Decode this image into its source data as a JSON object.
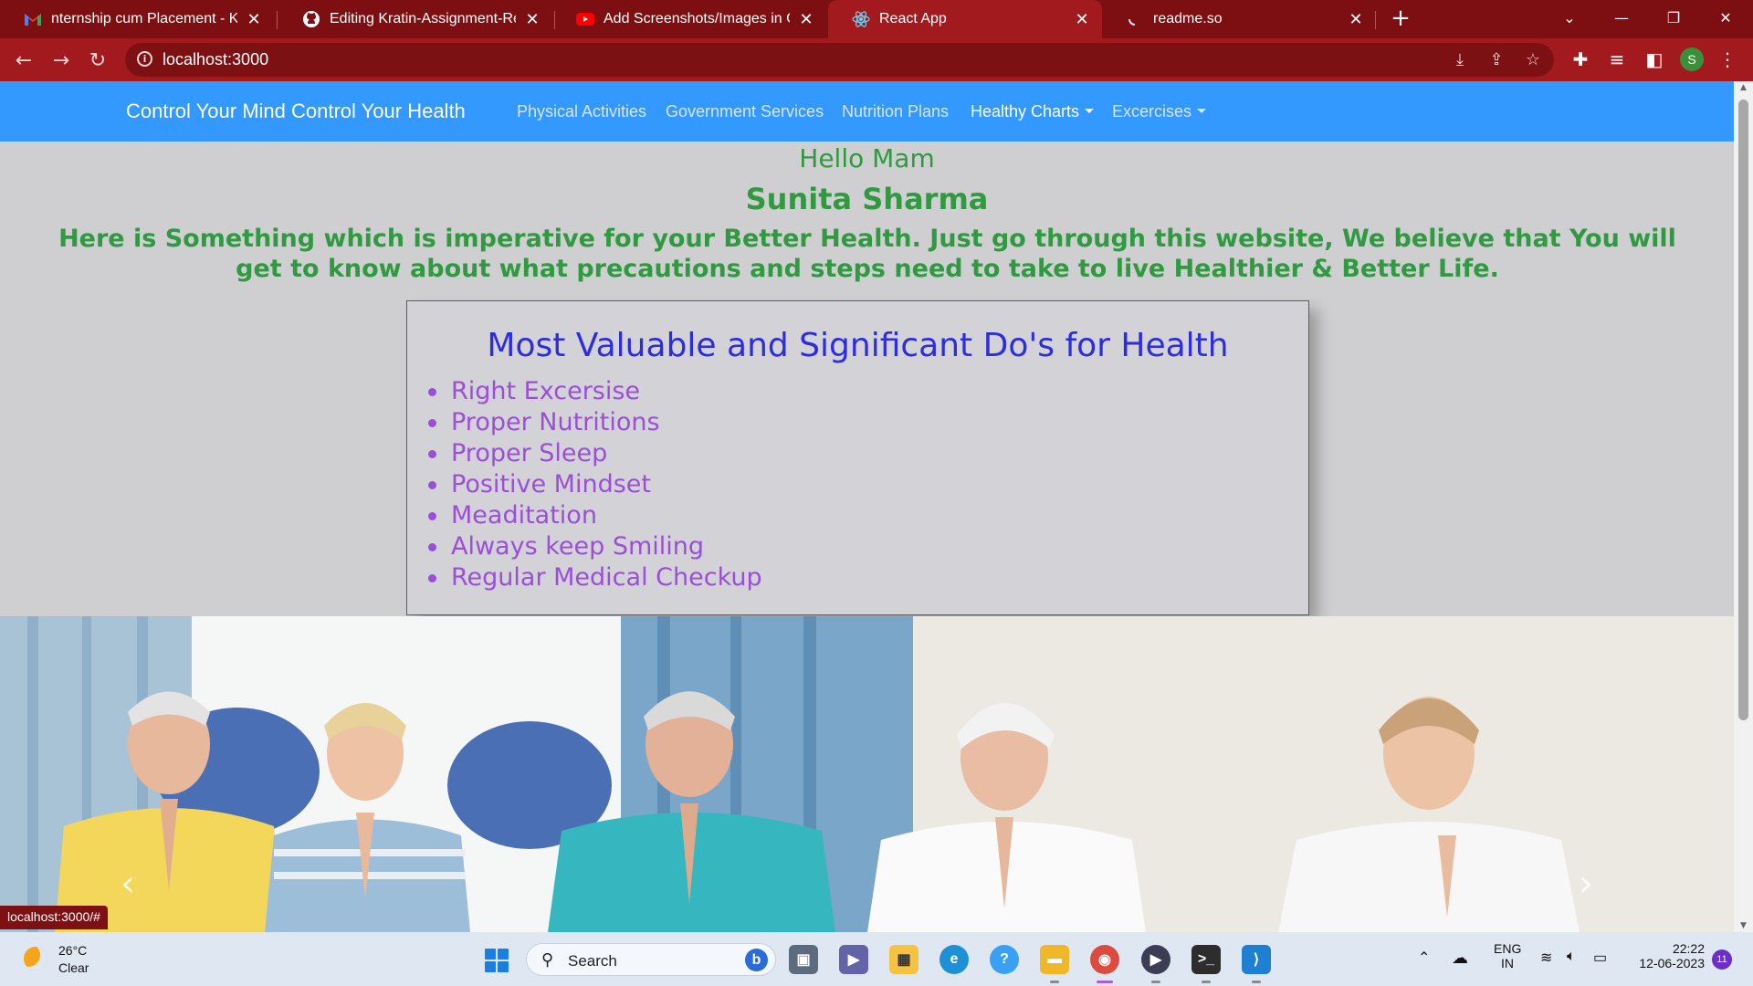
{
  "browser": {
    "tabs": [
      {
        "title": "nternship cum Placement - Kratin",
        "icon": "gmail-icon"
      },
      {
        "title": "Editing Kratin-Assignment-Repo/",
        "icon": "github-icon"
      },
      {
        "title": "Add Screenshots/Images in Githu",
        "icon": "youtube-icon"
      },
      {
        "title": "React App",
        "icon": "react-icon"
      },
      {
        "title": "readme.so",
        "icon": "loading-icon"
      }
    ],
    "active_tab": 3,
    "url": "localhost:3000",
    "profile_initial": "S",
    "status_link": "localhost:3000/#"
  },
  "navbar": {
    "brand": "Control Your Mind Control Your Health",
    "links": [
      "Physical Activities",
      "Government Services",
      "Nutrition Plans",
      "Healthy Charts",
      "Excercises"
    ]
  },
  "greeting": {
    "hello": "Hello Mam",
    "name": "Sunita Sharma",
    "intro": "Here is Something which is imperative for your Better Health. Just go through this website, We believe that You will get to know about what precautions and steps need to take to live Healthier & Better Life."
  },
  "dos": {
    "title": "Most Valuable and Significant Do's for Health",
    "items": [
      "Right Excersise",
      "Proper Nutritions",
      "Proper Sleep",
      "Positive Mindset",
      "Meaditation",
      "Always keep Smiling",
      "Regular Medical Checkup"
    ]
  },
  "carousel": {
    "prev": "‹",
    "next": "›"
  },
  "taskbar": {
    "weather_temp": "26°C",
    "weather_cond": "Clear",
    "search_label": "Search",
    "lang_top": "ENG",
    "lang_bottom": "IN",
    "time": "22:22",
    "date": "12-06-2023",
    "notifications": "11"
  },
  "colors": {
    "navbar": "#3399ff",
    "browser_frame": "#a31a1e",
    "greeting_text": "#2f9a3f",
    "dos_title": "#2c2ce0",
    "dos_items": "#9b4fd8"
  }
}
